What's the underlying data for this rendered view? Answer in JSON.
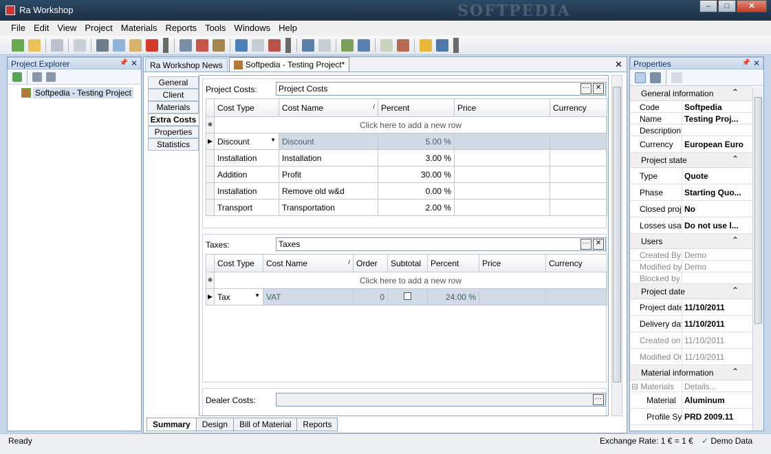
{
  "window": {
    "title": "Ra Workshop",
    "watermark": "SOFTPEDIA"
  },
  "menu": [
    "File",
    "Edit",
    "View",
    "Project",
    "Materials",
    "Reports",
    "Tools",
    "Windows",
    "Help"
  ],
  "explorer": {
    "title": "Project Explorer",
    "project": "Softpedia - Testing Project"
  },
  "doc_tabs": {
    "news": "Ra Workshop News",
    "project": "Softpedia - Testing Project*"
  },
  "side_tabs": {
    "general": "General",
    "client": "Client",
    "materials": "Materials",
    "extra_costs": "Extra Costs",
    "properties": "Properties",
    "statistics": "Statistics"
  },
  "project_costs": {
    "label": "Project Costs:",
    "field": "Project Costs",
    "columns": {
      "cost_type": "Cost Type",
      "cost_name": "Cost Name",
      "percent": "Percent",
      "price": "Price",
      "currency": "Currency"
    },
    "new_row": "Click here to add a new row",
    "rows": [
      {
        "type": "Discount",
        "name": "Discount",
        "percent": "5.00 %"
      },
      {
        "type": "Installation",
        "name": "Installation",
        "percent": "3.00 %"
      },
      {
        "type": "Addition",
        "name": "Profit",
        "percent": "30.00 %"
      },
      {
        "type": "Installation",
        "name": "Remove old w&d",
        "percent": "0.00 %"
      },
      {
        "type": "Transport",
        "name": "Transportation",
        "percent": "2.00 %"
      }
    ]
  },
  "taxes": {
    "label": "Taxes:",
    "field": "Taxes",
    "columns": {
      "cost_type": "Cost Type",
      "cost_name": "Cost Name",
      "order": "Order",
      "subtotal": "Subtotal",
      "percent": "Percent",
      "price": "Price",
      "currency": "Currency"
    },
    "new_row": "Click here to add a new row",
    "row": {
      "type": "Tax",
      "name": "VAT",
      "order": "0",
      "percent": "24.00 %"
    }
  },
  "dealer_costs": {
    "label": "Dealer Costs:"
  },
  "bottom_tabs": {
    "summary": "Summary",
    "design": "Design",
    "bom": "Bill of Material",
    "reports": "Reports"
  },
  "properties": {
    "title": "Properties",
    "general": {
      "title": "General information",
      "code_k": "Code",
      "code_v": "Softpedia",
      "name_k": "Name",
      "name_v": "Testing Proj...",
      "desc_k": "Description",
      "desc_v": "",
      "currency_k": "Currency",
      "currency_v": "European Euro"
    },
    "state": {
      "title": "Project state",
      "type_k": "Type",
      "type_v": "Quote",
      "phase_k": "Phase",
      "phase_v": "Starting Quo...",
      "closed_k": "Closed proje",
      "closed_v": "No",
      "losses_k": "Losses usag",
      "losses_v": "Do not use l..."
    },
    "users": {
      "title": "Users",
      "created_k": "Created By",
      "created_v": "Demo",
      "modified_k": "Modified by",
      "modified_v": "Demo",
      "blocked_k": "Blocked by",
      "blocked_v": ""
    },
    "date": {
      "title": "Project date",
      "pdate_k": "Project date",
      "pdate_v": "11/10/2011",
      "ddate_k": "Delivery dat",
      "ddate_v": "11/10/2011",
      "created_k": "Created on",
      "created_v": "11/10/2011",
      "modified_k": "Modified On",
      "modified_v": "11/10/2011"
    },
    "material": {
      "title": "Material information",
      "materials_k": "Materials",
      "materials_v": "Details...",
      "material_k": "Material",
      "material_v": "Aluminum",
      "profile_k": "Profile Sy:",
      "profile_v": "PRD 2009.11"
    }
  },
  "status": {
    "text": "Ready",
    "exchange": "Exchange Rate: 1 € = 1 €",
    "demo": "Demo Data"
  },
  "colors": {
    "accent": "#1c2f44",
    "selection": "#d1dbe6"
  }
}
